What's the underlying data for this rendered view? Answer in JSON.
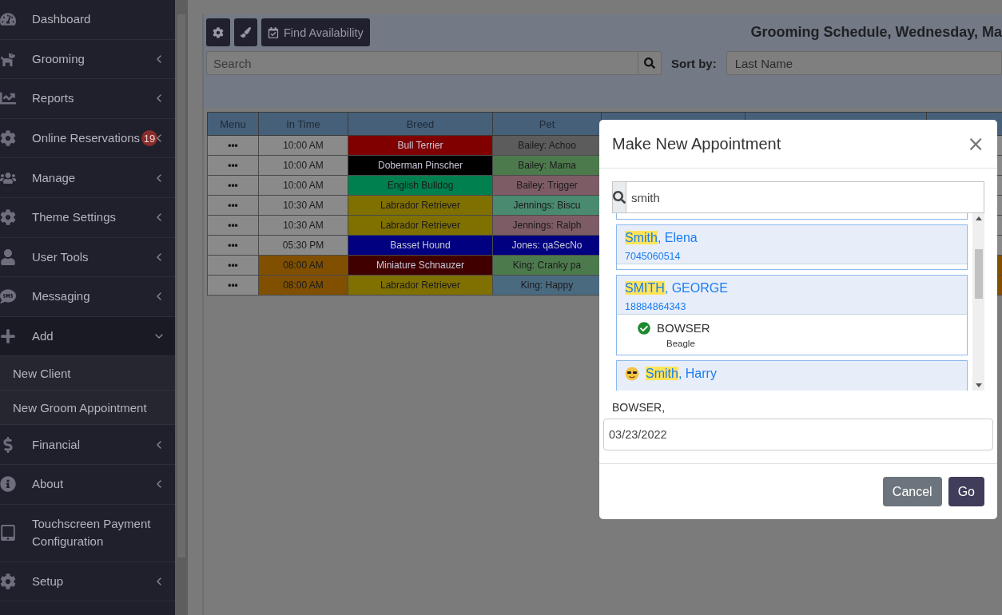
{
  "sidebar": {
    "items": [
      {
        "label": "Dashboard"
      },
      {
        "label": "Grooming",
        "expanded": false
      },
      {
        "label": "Reports",
        "expanded": false
      },
      {
        "label": "Online Reservations",
        "expanded": false,
        "badge": "19"
      },
      {
        "label": "Manage",
        "expanded": false
      },
      {
        "label": "Theme Settings",
        "expanded": false
      },
      {
        "label": "User Tools",
        "expanded": false
      },
      {
        "label": "Messaging",
        "expanded": false
      },
      {
        "label": "Add",
        "expanded": true,
        "children": [
          {
            "label": "New Client"
          },
          {
            "label": "New Groom Appointment"
          }
        ]
      },
      {
        "label": "Financial",
        "expanded": false
      },
      {
        "label": "About",
        "expanded": false
      },
      {
        "label": "Touchscreen Payment Configuration"
      },
      {
        "label": "Setup",
        "expanded": false
      }
    ]
  },
  "toolbar": {
    "find_button": "Find Availability",
    "title": "Grooming Schedule, Wednesday, Ma",
    "search": {
      "placeholder": "Search"
    },
    "sort_label": "Sort by:",
    "sort_value": "Last Name"
  },
  "table": {
    "columns": [
      "Menu",
      "In Time",
      "Breed",
      "Pet"
    ],
    "rows": [
      {
        "menu": "•••",
        "in_time": {
          "text": "10:00 AM",
          "color": "#8a8a8a"
        },
        "breed": {
          "text": "Bull Terrier",
          "color": "#800000"
        },
        "pet": {
          "text": "Bailey: Achoo",
          "color": "#5c5c5c"
        }
      },
      {
        "menu": "•••",
        "in_time": {
          "text": "10:00 AM",
          "color": "#8a8a8a"
        },
        "breed": {
          "text": "Doberman Pinscher",
          "color": "#000000"
        },
        "pet": {
          "text": "Bailey: Mama",
          "color": "#4d7a4d"
        }
      },
      {
        "menu": "•••",
        "in_time": {
          "text": "10:00 AM",
          "color": "#8a8a8a"
        },
        "breed": {
          "text": "English Bulldog",
          "color": "#00804f"
        },
        "pet": {
          "text": "Bailey: Trigger",
          "color": "#7d5c66"
        }
      },
      {
        "menu": "•••",
        "in_time": {
          "text": "10:30 AM",
          "color": "#8a8a8a"
        },
        "breed": {
          "text": "Labrador Retriever",
          "color": "#807000"
        },
        "pet": {
          "text": "Jennings: Biscu",
          "color": "#4a8a70"
        }
      },
      {
        "menu": "•••",
        "in_time": {
          "text": "10:30 AM",
          "color": "#8a8a8a"
        },
        "breed": {
          "text": "Labrador Retriever",
          "color": "#807000"
        },
        "pet": {
          "text": "Jennings: Ralph",
          "color": "#7d5c66"
        }
      },
      {
        "menu": "•••",
        "in_time": {
          "text": "05:30 PM",
          "color": "#8a8a8a"
        },
        "breed": {
          "text": "Basset Hound",
          "color": "#000080"
        },
        "pet": {
          "text": "Jones: qaSecNo",
          "color": "#000080"
        }
      },
      {
        "menu": "•••",
        "in_time": {
          "text": "08:00 AM",
          "color": "#805000"
        },
        "breed": {
          "text": "Miniature Schnauzer",
          "color": "#400000"
        },
        "pet": {
          "text": "King: Cranky pa",
          "color": "#4d7a4d"
        }
      },
      {
        "menu": "•••",
        "in_time": {
          "text": "08:00 AM",
          "color": "#805000"
        },
        "breed": {
          "text": "Labrador Retriever",
          "color": "#807000"
        },
        "pet": {
          "text": "King: Happy",
          "color": "#4a6a80"
        }
      }
    ]
  },
  "modal": {
    "title": "Make New Appointment",
    "close": "×",
    "search": {
      "value": "smith"
    },
    "results": [
      {
        "match": "Smith",
        "rest": ", Elena",
        "phone": "7045060514",
        "emoji": false
      },
      {
        "match": "SMITH",
        "rest": ", GEORGE",
        "phone": "18884864343",
        "emoji": false,
        "pets": [
          {
            "name": "BOWSER",
            "breed": "Beagle",
            "checked": true
          }
        ]
      },
      {
        "match": "Smith",
        "rest": ", Harry",
        "emoji": true
      }
    ],
    "selection_label": "BOWSER,",
    "date": "03/23/2022",
    "buttons": [
      {
        "label": "Cancel",
        "kind": "secondary"
      },
      {
        "label": "Go",
        "kind": "primary"
      }
    ]
  }
}
